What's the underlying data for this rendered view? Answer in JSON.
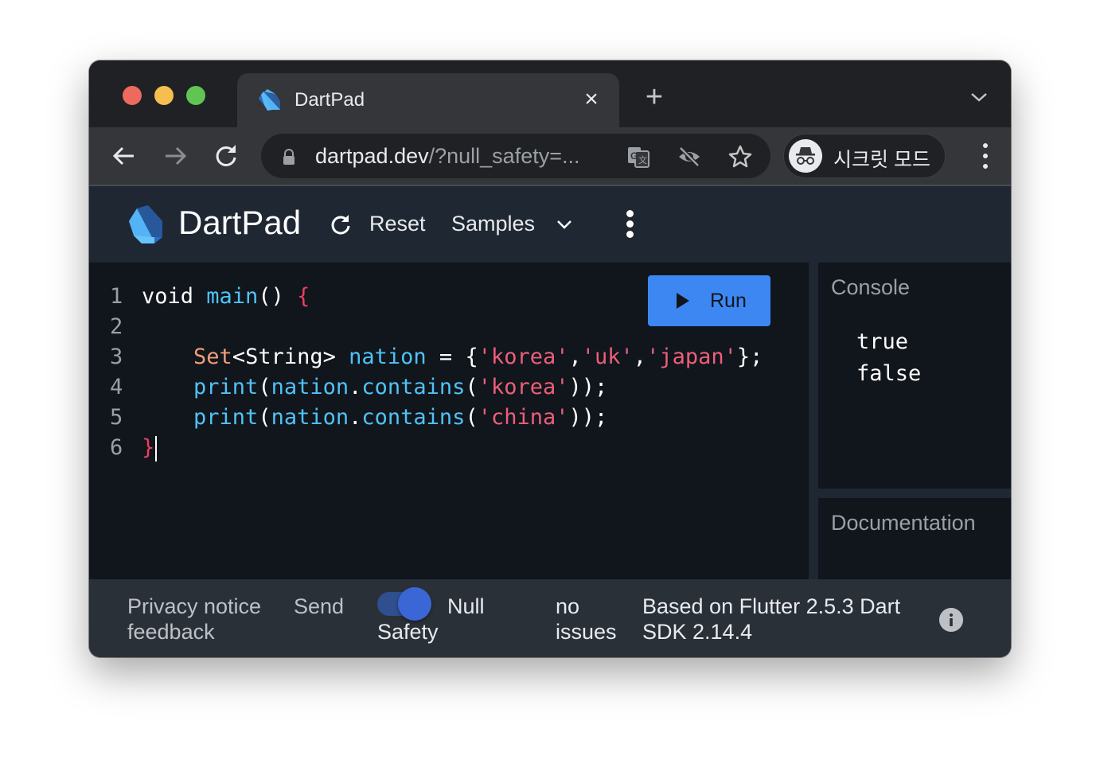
{
  "browser": {
    "tab": {
      "title": "DartPad",
      "close_glyph": "×",
      "icon": "dart-logo-icon"
    },
    "new_tab_glyph": "+",
    "tab_search_icon": "chevron-down-icon",
    "nav": {
      "back_icon": "arrow-left-icon",
      "forward_icon": "arrow-right-icon",
      "reload_icon": "reload-icon"
    },
    "address": {
      "host": "dartpad.dev",
      "rest": "/?null_safety=..."
    },
    "omnibox_icons": [
      "translate-icon",
      "eye-off-icon",
      "star-icon"
    ],
    "incognito_label": "시크릿 모드",
    "menu_icon": "kebab-menu-icon"
  },
  "dartpad": {
    "title": "DartPad",
    "reset_label": "Reset",
    "samples_label": "Samples",
    "run_label": "Run",
    "console_title": "Console",
    "documentation_title": "Documentation",
    "console_output": [
      "true",
      "false"
    ],
    "code_lines": [
      {
        "n": "1",
        "tokens": [
          {
            "t": "void ",
            "c": "kw"
          },
          {
            "t": "main",
            "c": "fn"
          },
          {
            "t": "() ",
            "c": "kw"
          },
          {
            "t": "{",
            "c": "brace"
          }
        ]
      },
      {
        "n": "2",
        "tokens": []
      },
      {
        "n": "3",
        "tokens": [
          {
            "t": "    ",
            "c": "kw"
          },
          {
            "t": "Set",
            "c": "ty"
          },
          {
            "t": "<String> ",
            "c": "kw"
          },
          {
            "t": "nation",
            "c": "fn"
          },
          {
            "t": " = {",
            "c": "kw"
          },
          {
            "t": "'korea'",
            "c": "str"
          },
          {
            "t": ",",
            "c": "kw"
          },
          {
            "t": "'uk'",
            "c": "str"
          },
          {
            "t": ",",
            "c": "kw"
          },
          {
            "t": "'japan'",
            "c": "str"
          },
          {
            "t": "};",
            "c": "kw"
          }
        ]
      },
      {
        "n": "4",
        "tokens": [
          {
            "t": "    ",
            "c": "kw"
          },
          {
            "t": "print",
            "c": "fn"
          },
          {
            "t": "(",
            "c": "kw"
          },
          {
            "t": "nation",
            "c": "fn"
          },
          {
            "t": ".",
            "c": "kw"
          },
          {
            "t": "contains",
            "c": "fn"
          },
          {
            "t": "(",
            "c": "kw"
          },
          {
            "t": "'korea'",
            "c": "str"
          },
          {
            "t": "));",
            "c": "kw"
          }
        ]
      },
      {
        "n": "5",
        "tokens": [
          {
            "t": "    ",
            "c": "kw"
          },
          {
            "t": "print",
            "c": "fn"
          },
          {
            "t": "(",
            "c": "kw"
          },
          {
            "t": "nation",
            "c": "fn"
          },
          {
            "t": ".",
            "c": "kw"
          },
          {
            "t": "contains",
            "c": "fn"
          },
          {
            "t": "(",
            "c": "kw"
          },
          {
            "t": "'china'",
            "c": "str"
          },
          {
            "t": "));",
            "c": "kw"
          }
        ]
      },
      {
        "n": "6",
        "tokens": [
          {
            "t": "}",
            "c": "brace"
          }
        ]
      }
    ]
  },
  "footer": {
    "privacy_notice": "Privacy notice",
    "send_feedback_1": "Send",
    "send_feedback_2": "feedback",
    "null_safety_1": "Null",
    "null_safety_2": "Safety",
    "null_safety_enabled": true,
    "issues_1": "no",
    "issues_2": "issues",
    "version_1": "Based on Flutter 2.5.3 Dart",
    "version_2": "SDK 2.14.4"
  },
  "colors": {
    "run_button": "#3d87f2",
    "editor_bg": "#11151c",
    "header_bg": "#1f2733",
    "footer_bg": "#2a3038",
    "toggle_on": "#3a66d6"
  }
}
